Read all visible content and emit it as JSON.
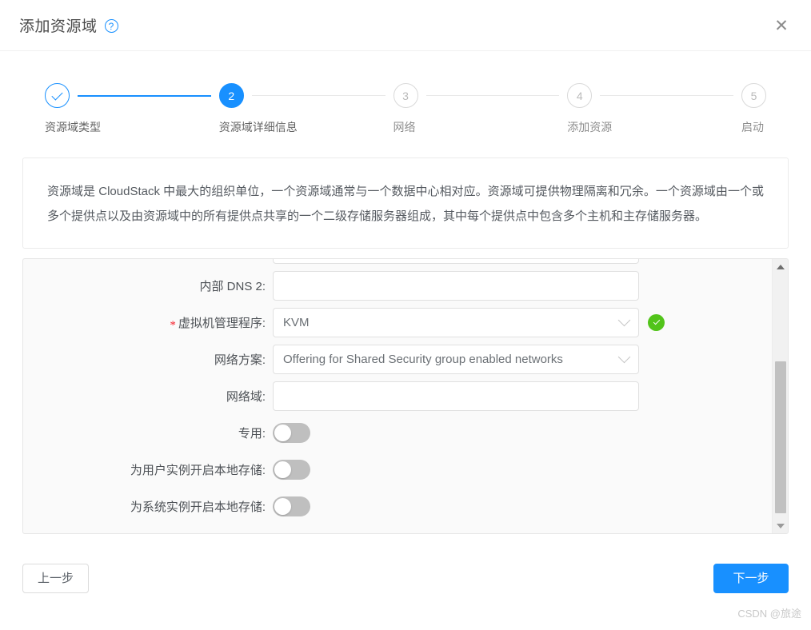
{
  "header": {
    "title": "添加资源域",
    "help_icon": "question-circle-icon",
    "close_icon": "✕"
  },
  "steps": [
    {
      "num": "1",
      "label": "资源域类型",
      "state": "finished",
      "icon": "check-icon"
    },
    {
      "num": "2",
      "label": "资源域详细信息",
      "state": "process"
    },
    {
      "num": "3",
      "label": "网络",
      "state": "wait"
    },
    {
      "num": "4",
      "label": "添加资源",
      "state": "wait"
    },
    {
      "num": "5",
      "label": "启动",
      "state": "wait"
    }
  ],
  "description": {
    "text": "资源域是 CloudStack 中最大的组织单位，一个资源域通常与一个数据中心相对应。资源域可提供物理隔离和冗余。一个资源域由一个或多个提供点以及由资源域中的所有提供点共享的一个二级存储服务器组成，其中每个提供点中包含多个主机和主存储服务器。"
  },
  "form": {
    "fields": [
      {
        "label": "内部 DNS 2:",
        "required": false,
        "type": "text",
        "value": "",
        "placeholder": ""
      },
      {
        "label": "虚拟机管理程序:",
        "required": true,
        "type": "select",
        "value": "KVM",
        "valid": true
      },
      {
        "label": "网络方案:",
        "required": false,
        "type": "select",
        "value": "Offering for Shared Security group enabled networks",
        "valid": false
      },
      {
        "label": "网络域:",
        "required": false,
        "type": "text",
        "value": "",
        "placeholder": ""
      },
      {
        "label": "专用:",
        "required": false,
        "type": "switch",
        "value": "off"
      },
      {
        "label": "为用户实例开启本地存储:",
        "required": false,
        "type": "switch",
        "value": "off"
      },
      {
        "label": "为系统实例开启本地存储:",
        "required": false,
        "type": "switch",
        "value": "off"
      }
    ],
    "scrollbar": {
      "up_icon": "caret-up-icon",
      "down_icon": "caret-down-icon"
    }
  },
  "footer": {
    "prev_label": "上一步",
    "next_label": "下一步"
  },
  "watermark": {
    "text": "CSDN @旅途"
  },
  "colors": {
    "primary": "#1890ff",
    "success": "#52c41a",
    "required_star": "#f5222d",
    "panel_bg": "#fafafa",
    "switch_off": "#bfbfbf"
  }
}
